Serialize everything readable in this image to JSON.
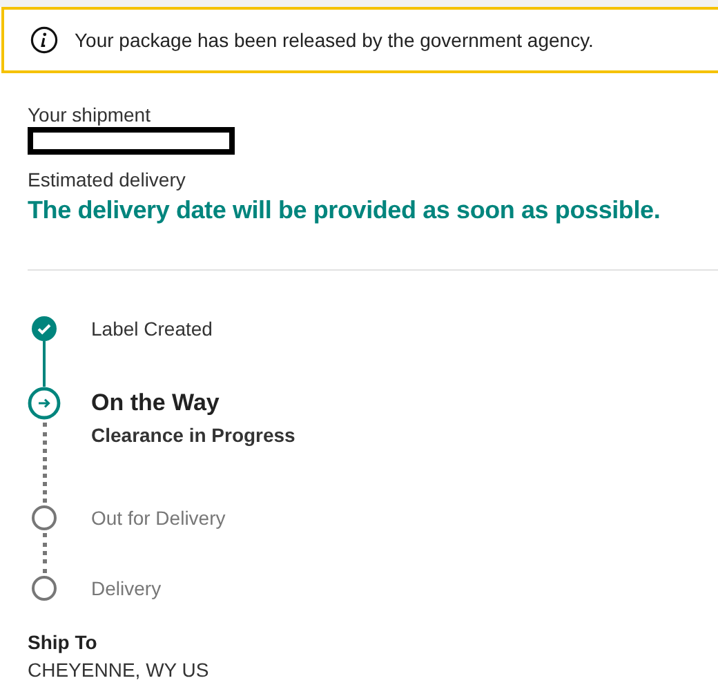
{
  "alert": {
    "message": "Your package has been released by the government agency."
  },
  "shipment": {
    "label": "Your shipment",
    "redacted": true
  },
  "estimated_delivery": {
    "label": "Estimated delivery",
    "value": "The delivery date will be provided as soon as possible."
  },
  "progress": [
    {
      "label": "Label Created",
      "kind": "done"
    },
    {
      "label": "On the Way",
      "detail": "Clearance in Progress",
      "kind": "current"
    },
    {
      "label": "Out for Delivery",
      "kind": "pending"
    },
    {
      "label": "Delivery",
      "kind": "pending"
    }
  ],
  "ship_to": {
    "label": "Ship To",
    "value": "CHEYENNE, WY US"
  }
}
